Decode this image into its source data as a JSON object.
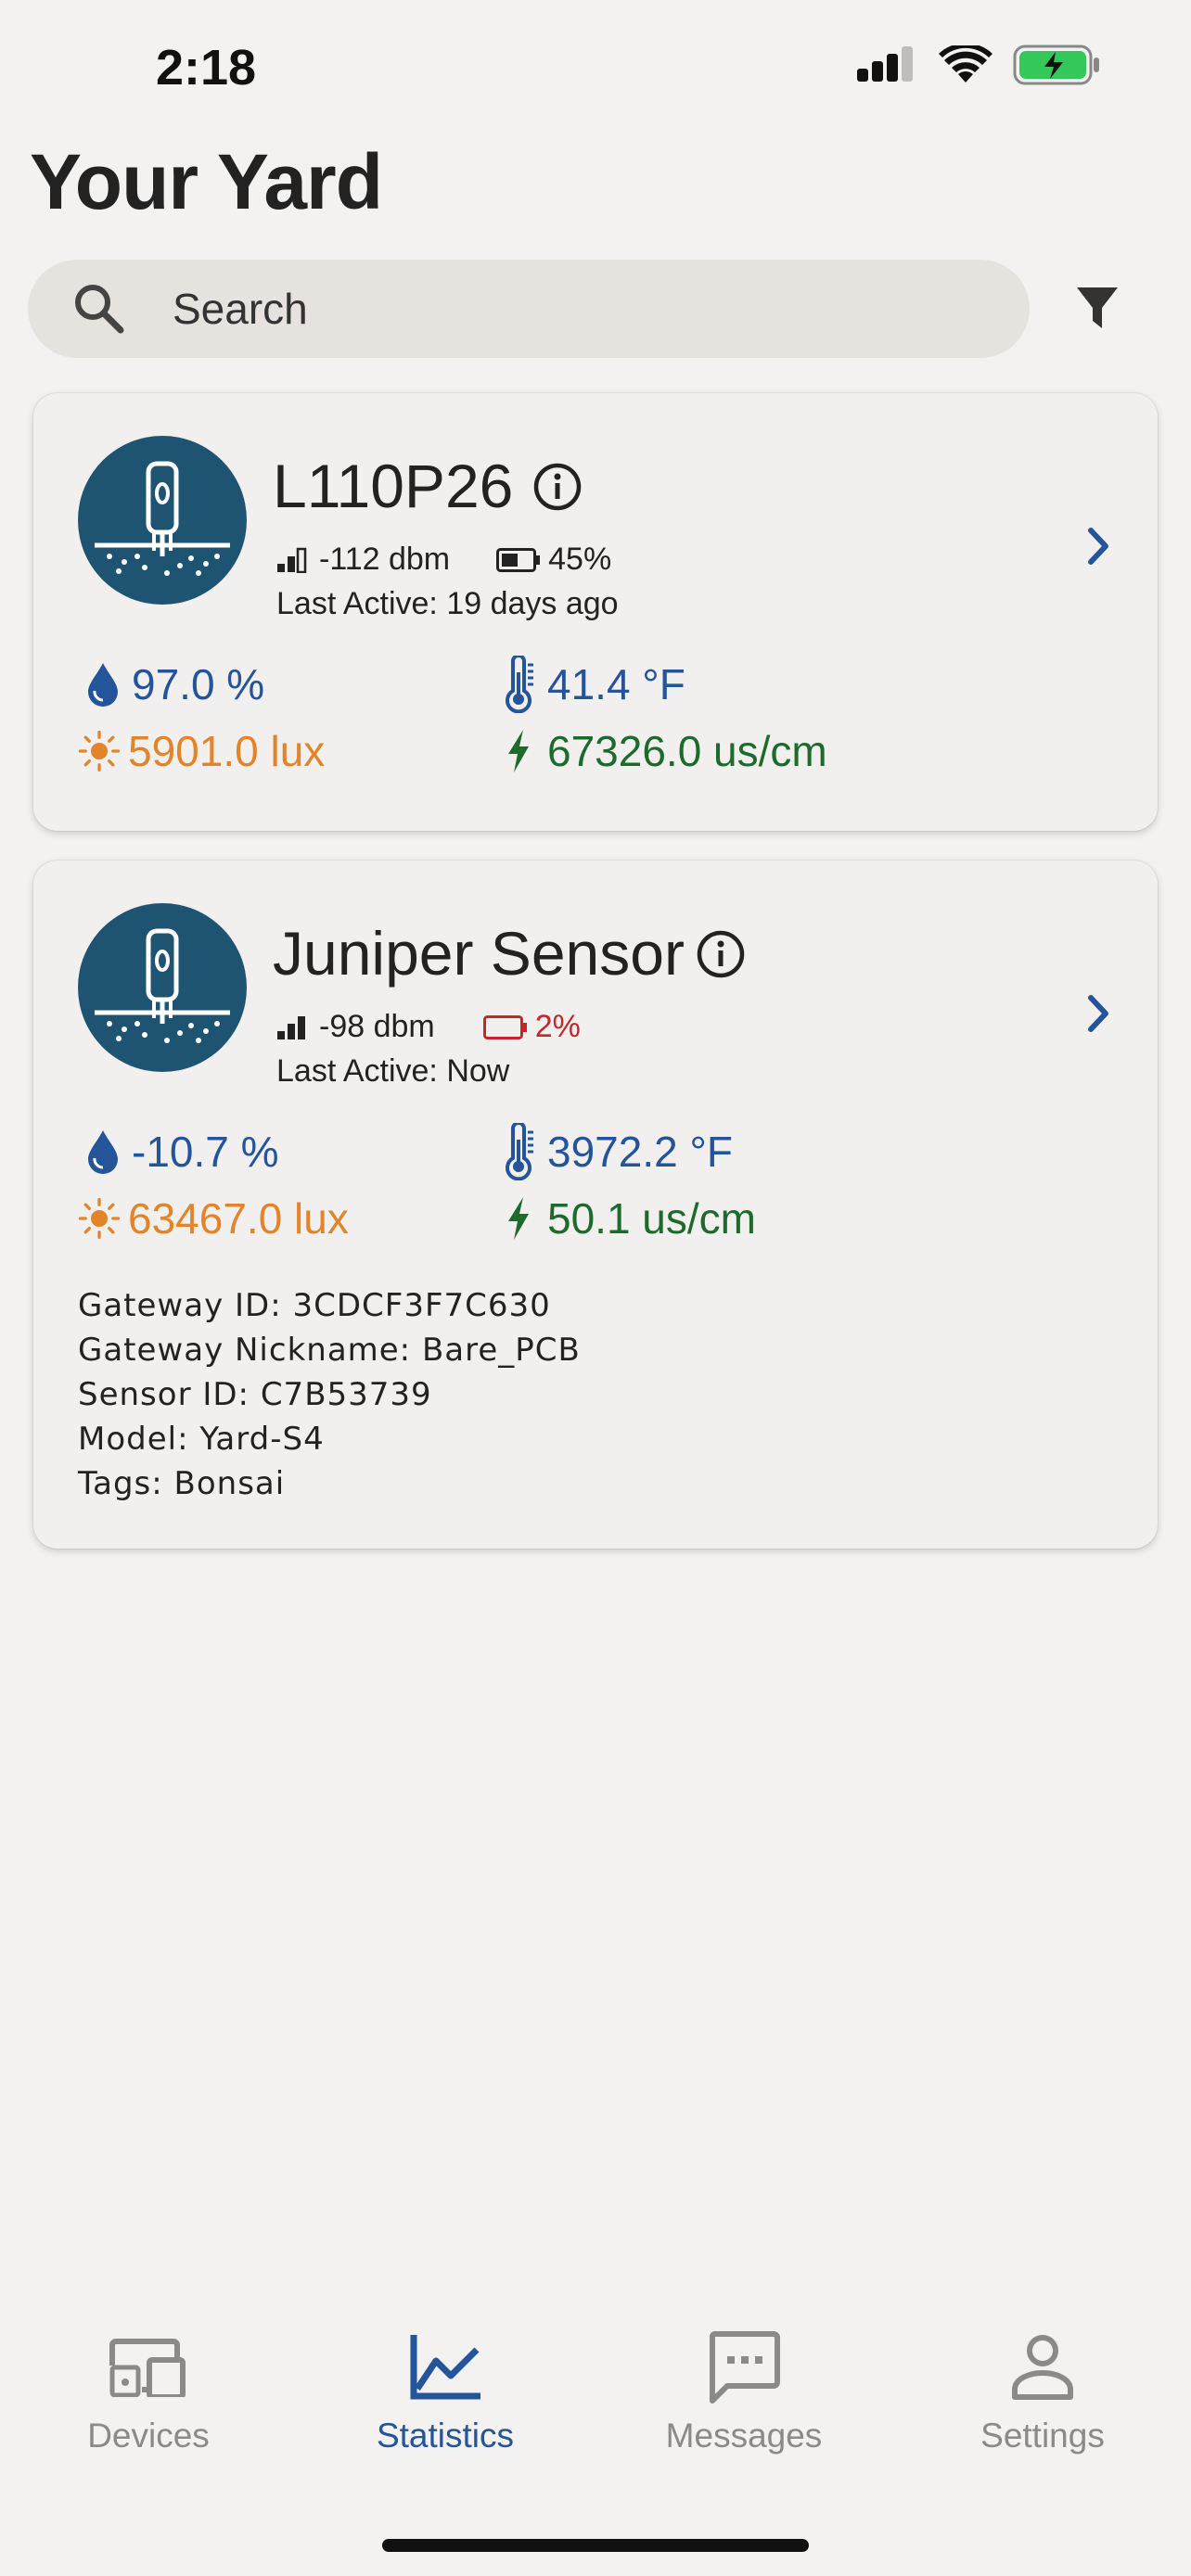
{
  "status_bar": {
    "time": "2:18"
  },
  "page_title": "Your Yard",
  "search": {
    "placeholder": "Search"
  },
  "colors": {
    "accent": "#24549a",
    "orange": "#e2842a",
    "green": "#1d6b2c",
    "battery_low": "#c0282a",
    "avatar_bg": "#1e5472"
  },
  "devices": [
    {
      "name": "L110P26",
      "signal": "-112 dbm",
      "battery": "45%",
      "battery_level": 0.45,
      "last_active": "Last Active: 19 days ago",
      "moisture": "97.0 %",
      "temperature": "41.4 °F",
      "light": "5901.0 lux",
      "conductivity": "67326.0 us/cm"
    },
    {
      "name": "Juniper Sensor",
      "signal": "-98 dbm",
      "battery": "2%",
      "battery_level": 0.02,
      "last_active": "Last Active: Now",
      "moisture": "-10.7 %",
      "temperature": "3972.2 °F",
      "light": "63467.0 lux",
      "conductivity": "50.1 us/cm",
      "details": {
        "gateway_id": "Gateway ID: 3CDCF3F7C630",
        "gateway_nickname": "Gateway Nickname: Bare_PCB",
        "sensor_id": "Sensor ID: C7B53739",
        "model": "Model: Yard-S4",
        "tags": "Tags: Bonsai"
      }
    }
  ],
  "tabs": [
    {
      "label": "Devices",
      "icon": "devices-icon",
      "active": false
    },
    {
      "label": "Statistics",
      "icon": "chart-line-icon",
      "active": true
    },
    {
      "label": "Messages",
      "icon": "message-icon",
      "active": false
    },
    {
      "label": "Settings",
      "icon": "person-icon",
      "active": false
    }
  ]
}
